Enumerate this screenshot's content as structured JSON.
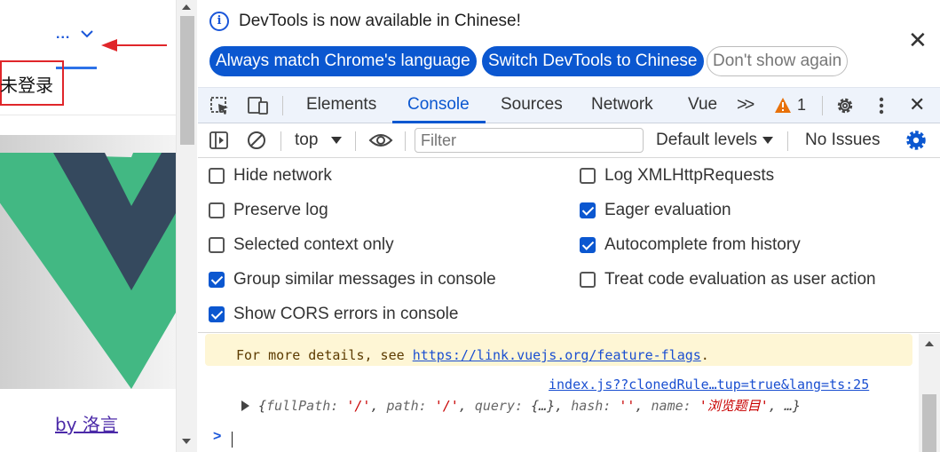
{
  "page": {
    "menu_dots": "...",
    "login_status": "未登录",
    "footer_link": "by 洛言"
  },
  "devtools": {
    "infobar": {
      "message": "DevTools is now available in Chinese!",
      "info_glyph": "i",
      "close_glyph": "✕",
      "btn_match": "Always match Chrome's language",
      "btn_switch": "Switch DevTools to Chinese",
      "btn_dismiss": "Don't show again"
    },
    "tabs": {
      "elements": "Elements",
      "console": "Console",
      "sources": "Sources",
      "network": "Network",
      "vue": "Vue",
      "more": ">>",
      "warning_count": "1",
      "close_glyph": "✕"
    },
    "toolbar": {
      "context": "top",
      "filter_placeholder": "Filter",
      "levels": "Default levels",
      "issues": "No Issues"
    },
    "settings": {
      "left": [
        {
          "label": "Hide network",
          "checked": false
        },
        {
          "label": "Preserve log",
          "checked": false
        },
        {
          "label": "Selected context only",
          "checked": false
        },
        {
          "label": "Group similar messages in console",
          "checked": true
        },
        {
          "label": "Show CORS errors in console",
          "checked": true
        }
      ],
      "right": [
        {
          "label": "Log XMLHttpRequests",
          "checked": false
        },
        {
          "label": "Eager evaluation",
          "checked": true
        },
        {
          "label": "Autocomplete from history",
          "checked": true
        },
        {
          "label": "Treat code evaluation as user action",
          "checked": false
        }
      ]
    },
    "console": {
      "warning_prefix": "For more details, see ",
      "warning_link": "https://link.vuejs.org/feature-flags",
      "warning_suffix": ".",
      "source_link": "index.js??clonedRule…tup=true&lang=ts:25",
      "object": {
        "open": "{",
        "k1": "fullPath:",
        "v1": "'/'",
        "k2": "path:",
        "v2": "'/'",
        "k3": "query:",
        "v3": "{…}",
        "k4": "hash:",
        "v4": "''",
        "k5": "name:",
        "v5": "'浏览题目'",
        "tail": "…}"
      },
      "prompt_glyph": ">"
    },
    "colors": {
      "accent": "#0b57d0",
      "warning_bg": "#fef6d5",
      "string_red": "#c80000"
    }
  }
}
